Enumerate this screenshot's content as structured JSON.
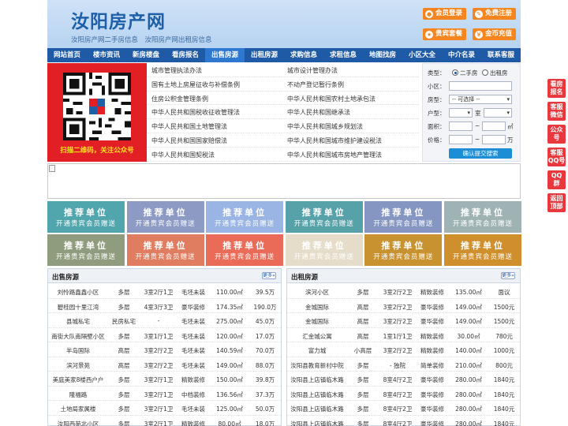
{
  "header": {
    "logo": "汝阳房产网",
    "tagline": "汝阳房产网二手房信息　汝阳房产网出租房信息",
    "buttons": [
      {
        "label": "会员登录",
        "icon": "user-icon",
        "glyph": "●"
      },
      {
        "label": "免费注册",
        "icon": "register-icon",
        "glyph": "✎"
      },
      {
        "label": "贵宾套餐",
        "icon": "vip-icon",
        "glyph": "★"
      },
      {
        "label": "金币充值",
        "icon": "coin-icon",
        "glyph": "￥"
      }
    ]
  },
  "nav": [
    "网站首页",
    "楼市资讯",
    "新房楼盘",
    "看房报名",
    "出售房源",
    "出租房源",
    "求购信息",
    "求租信息",
    "地图找房",
    "小区大全",
    "中介名录",
    "联系客服"
  ],
  "qr": {
    "caption": "扫描二维码，关注公众号"
  },
  "links": [
    [
      "城市管理执法办法",
      "城市设计管理办法"
    ],
    [
      "国有土地上房屋征收与补偿条例",
      "不动产登记暂行条例"
    ],
    [
      "住房公积金管理条例",
      "中华人民共和国农村土地承包法"
    ],
    [
      "中华人民共和国税收征收管理法",
      "中华人民共和国继承法"
    ],
    [
      "中华人民共和国土地管理法",
      "中华人民共和国城乡规划法"
    ],
    [
      "中华人民共和国国家赔偿法",
      "中华人民共和国城市维护建设税法"
    ],
    [
      "中华人民共和国契税法",
      "中华人民共和国城市房地产管理法"
    ]
  ],
  "search": {
    "type_label": "类型：",
    "type_options": [
      "二手房",
      "出租房"
    ],
    "community_label": "小区：",
    "house_type_label": "房型：",
    "house_type_value": "-- 可选择 --",
    "layout_label": "户型：",
    "room_unit": "室",
    "area_label": "面积：",
    "area_unit": "㎡",
    "price_label": "价格：",
    "price_unit": "万",
    "range_sep": "~",
    "submit": "确认提交搜索"
  },
  "ads": {
    "title": "推荐单位",
    "subtitle": "开通贵宾会员赠送",
    "colors": [
      "#51a5ad",
      "#8c9ac4",
      "#9ab5e3",
      "#57a2a8",
      "#8696c2",
      "#9fb3b5",
      "#8f9d7e",
      "#e07c5f",
      "#ea6b58",
      "#e5ddc9",
      "#c99230",
      "#cf8f2c"
    ]
  },
  "sale": {
    "title": "出售房源",
    "more": "更多»",
    "rows": [
      [
        "刘怜路鑫鑫小区",
        "多层",
        "3室2厅1卫",
        "毛坯未装",
        "110.00㎡",
        "39.5万"
      ],
      [
        "碧桂园十里江湾",
        "多层",
        "4室3厅3卫",
        "豪华装修",
        "174.35㎡",
        "190.0万"
      ],
      [
        "县城私宅",
        "民房私宅",
        "-",
        "毛坯未装",
        "275.00㎡",
        "45.0万"
      ],
      [
        "南街大队南隔壁小区",
        "多层",
        "3室1厅1卫",
        "毛坯未装",
        "120.00㎡",
        "17.0万"
      ],
      [
        "半岛国际",
        "高层",
        "3室2厅2卫",
        "毛坯未装",
        "140.59㎡",
        "70.0万"
      ],
      [
        "滨河景苑",
        "高层",
        "3室2厅2卫",
        "毛坯未装",
        "149.00㎡",
        "88.0万"
      ],
      [
        "美庭美家8楼西户户",
        "多层",
        "3室2厅1卫",
        "精致装修",
        "150.00㎡",
        "39.8万"
      ],
      [
        "隆福路",
        "多层",
        "3室2厅1卫",
        "中档装修",
        "136.56㎡",
        "37.3万"
      ],
      [
        "土地局家属楼",
        "多层",
        "3室2厅1卫",
        "毛坯未装",
        "125.00㎡",
        "50.0万"
      ],
      [
        "汝阳西苑北小区",
        "多层",
        "3室2厅1卫",
        "精致装修",
        "80.00㎡",
        "18.0万"
      ]
    ]
  },
  "rent": {
    "title": "出租房源",
    "more": "更多»",
    "rows": [
      [
        "滨河小区",
        "多层",
        "3室2厅2卫",
        "精致装修",
        "135.00㎡",
        "面议"
      ],
      [
        "金城国际",
        "高层",
        "3室2厅2卫",
        "豪华装修",
        "149.00㎡",
        "1500元"
      ],
      [
        "金城国际",
        "高层",
        "3室2厅2卫",
        "豪华装修",
        "149.00㎡",
        "1500元"
      ],
      [
        "汇金城公寓",
        "高层",
        "1室1厅1卫",
        "精致装修",
        "30.00㎡",
        "780元"
      ],
      [
        "富力城",
        "小高层",
        "3室2厅2卫",
        "精致装修",
        "140.00㎡",
        "1000元"
      ],
      [
        "汝阳县教育新村中院",
        "多层",
        "- 独院",
        "简单装修",
        "210.00㎡",
        "800元"
      ],
      [
        "汝阳县上店镇临木路",
        "多层",
        "8室4厅2卫",
        "豪华装修",
        "280.00㎡",
        "1840元"
      ],
      [
        "汝阳县上店镇临木路",
        "多层",
        "8室4厅2卫",
        "豪华装修",
        "280.00㎡",
        "1840元"
      ],
      [
        "汝阳县上店镇临木路",
        "多层",
        "8室4厅2卫",
        "豪华装修",
        "280.00㎡",
        "1840元"
      ],
      [
        "汝阳县上店镇临木路",
        "多层",
        "8室4厅2卫",
        "豪华装修",
        "280.00㎡",
        "1840元"
      ]
    ]
  },
  "float": [
    [
      "看房",
      "报名"
    ],
    [
      "客服",
      "微信"
    ],
    [
      "公众",
      "号"
    ],
    [
      "客服",
      "QQ号"
    ],
    [
      "QQ",
      "群"
    ],
    [
      "返回",
      "顶部"
    ]
  ]
}
